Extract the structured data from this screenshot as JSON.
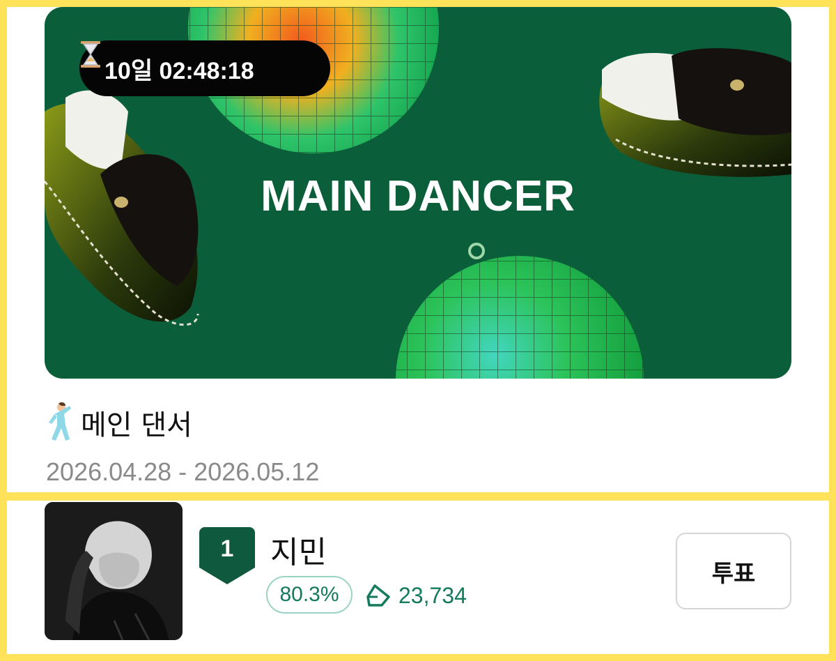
{
  "banner": {
    "countdown": "10일 02:48:18",
    "title": "MAIN DANCER"
  },
  "category": {
    "title": "메인 댄서",
    "date_range": "2026.04.28 - 2026.05.12"
  },
  "ranking": [
    {
      "rank": "1",
      "name": "지민",
      "percent": "80.3%",
      "votes": "23,734",
      "vote_button": "투표"
    }
  ],
  "colors": {
    "frame": "#FDE25A",
    "banner_bg": "#0B5E3A",
    "accent": "#147a5c"
  },
  "icons": [
    "hourglass-icon",
    "dancer-icon",
    "rank-badge-icon",
    "diamond-icon"
  ]
}
